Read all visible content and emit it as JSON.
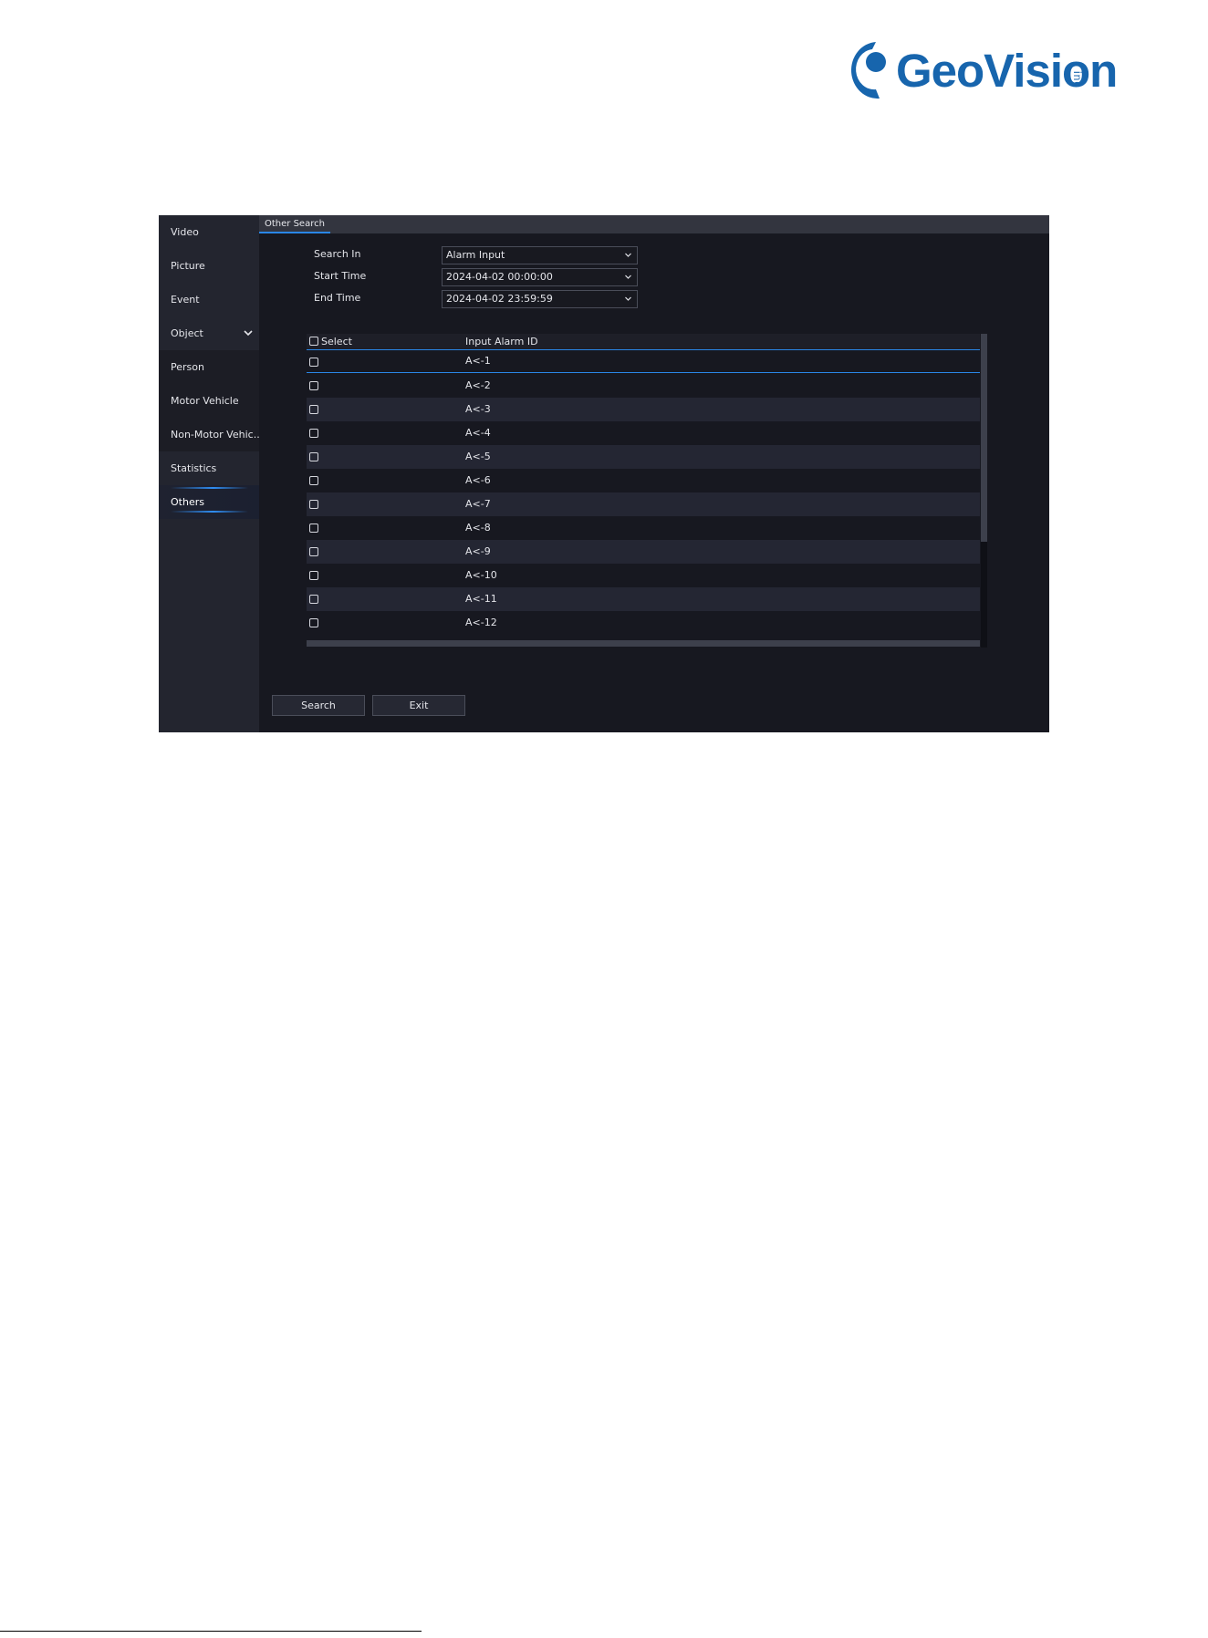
{
  "logo": {
    "text": "GeoVision",
    "suffix": "inc"
  },
  "colors": {
    "brand": "#1765ad",
    "accent": "#2a86e6",
    "panel_bg": "#171820",
    "sidebar_bg": "#23252f"
  },
  "sidebar": {
    "items": [
      {
        "label": "Video"
      },
      {
        "label": "Picture"
      },
      {
        "label": "Event"
      },
      {
        "label": "Object",
        "icon": "chevron-down-icon"
      },
      {
        "label": "Person"
      },
      {
        "label": "Motor Vehicle"
      },
      {
        "label": "Non-Motor Vehic.."
      },
      {
        "label": "Statistics"
      },
      {
        "label": "Others"
      }
    ]
  },
  "tab": {
    "label": "Other Search"
  },
  "form": {
    "search_in": {
      "label": "Search In",
      "value": "Alarm Input"
    },
    "start_time": {
      "label": "Start Time",
      "value": "2024-04-02 00:00:00"
    },
    "end_time": {
      "label": "End Time",
      "value": "2024-04-02 23:59:59"
    }
  },
  "table": {
    "columns": [
      "Select",
      "Input Alarm ID"
    ],
    "rows": [
      {
        "id": "A<-1"
      },
      {
        "id": "A<-2"
      },
      {
        "id": "A<-3"
      },
      {
        "id": "A<-4"
      },
      {
        "id": "A<-5"
      },
      {
        "id": "A<-6"
      },
      {
        "id": "A<-7"
      },
      {
        "id": "A<-8"
      },
      {
        "id": "A<-9"
      },
      {
        "id": "A<-10"
      },
      {
        "id": "A<-11"
      },
      {
        "id": "A<-12"
      }
    ]
  },
  "buttons": {
    "search": "Search",
    "exit": "Exit"
  }
}
